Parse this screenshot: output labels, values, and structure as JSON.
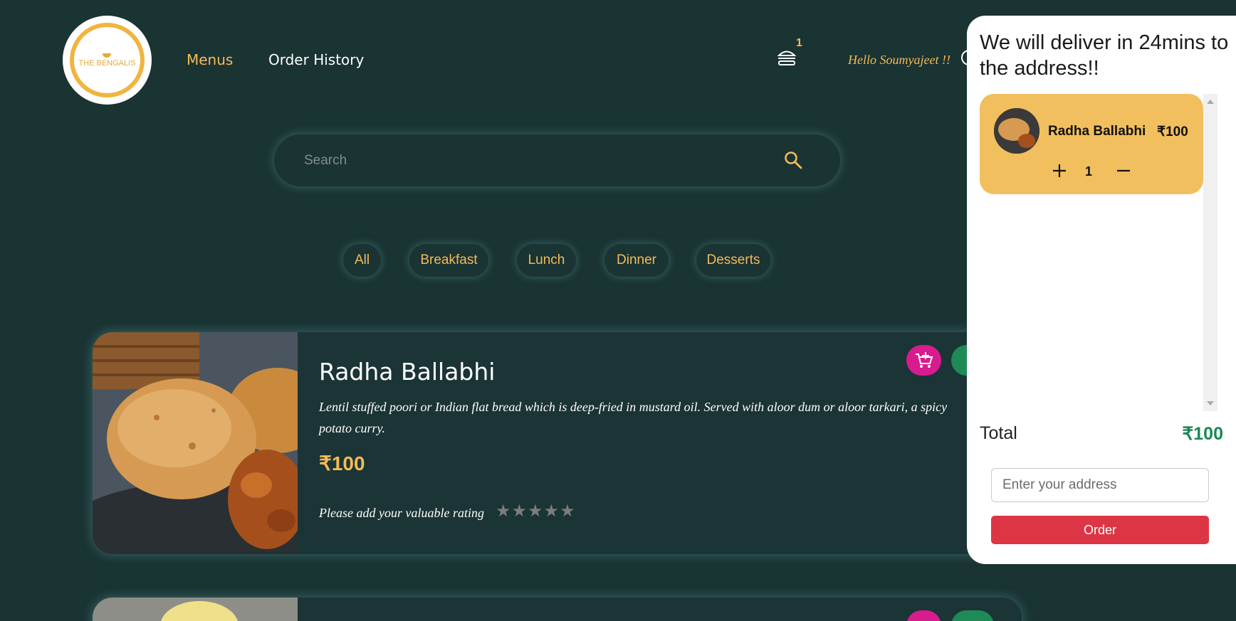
{
  "header": {
    "logo_text": "THE BENGALIS",
    "nav": [
      {
        "label": "Menus",
        "active": true
      },
      {
        "label": "Order History",
        "active": false
      }
    ],
    "cart_icon": "burger-icon",
    "cart_count": "1",
    "greeting": "Hello Soumyajeet !!",
    "user_icon": "user-icon"
  },
  "search": {
    "placeholder": "Search",
    "value": "",
    "icon": "search-icon"
  },
  "filters": [
    "All",
    "Breakfast",
    "Lunch",
    "Dinner",
    "Desserts"
  ],
  "menu_items": [
    {
      "title": "Radha Ballabhi",
      "description": "Lentil stuffed poori or Indian flat bread which is deep-fried in mustard oil. Served with aloor dum or aloor tarkari, a spicy potato curry.",
      "price": "₹100",
      "rating_prompt": "Please add your valuable rating",
      "rating": 0,
      "rating_max": 5
    }
  ],
  "cart_panel": {
    "title": "We will deliver in 24mins to the address!!",
    "items": [
      {
        "name": "Radha Ballabhi",
        "price": "₹100",
        "quantity": "1"
      }
    ],
    "total_label": "Total",
    "total_value": "₹100",
    "address_placeholder": "Enter your address",
    "address_value": "",
    "order_label": "Order"
  },
  "colors": {
    "background": "#1a3333",
    "accent": "#f3bb58",
    "cart_button": "#d81b8f",
    "green_button": "#1e8a56",
    "cart_item_bg": "#f2bf5e",
    "total": "#198754",
    "order_button": "#dc3545"
  }
}
